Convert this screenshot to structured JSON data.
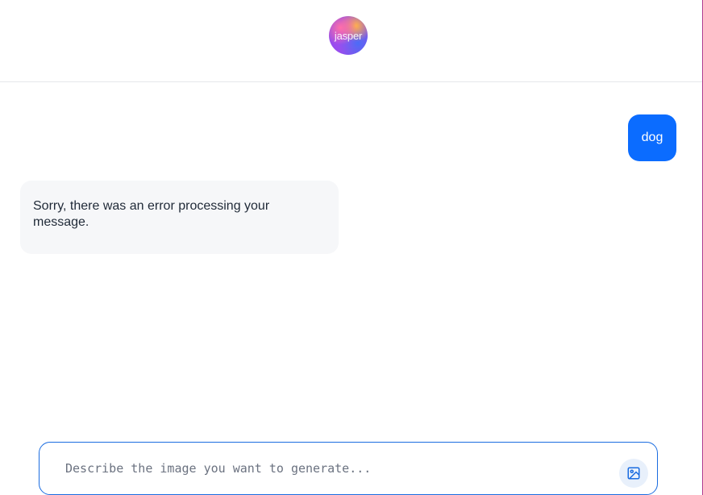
{
  "header": {
    "logo_text": "jasper"
  },
  "conversation": {
    "messages": [
      {
        "role": "user",
        "text": "dog"
      },
      {
        "role": "assistant",
        "text": "Sorry, there was an error processing your message."
      }
    ]
  },
  "composer": {
    "placeholder": "Describe the image you want to generate...",
    "value": "",
    "image_button_icon": "image-icon"
  },
  "colors": {
    "accent": "#0b6cff",
    "input_border": "#1a6ce0",
    "bot_bubble": "#f6f7f9"
  }
}
